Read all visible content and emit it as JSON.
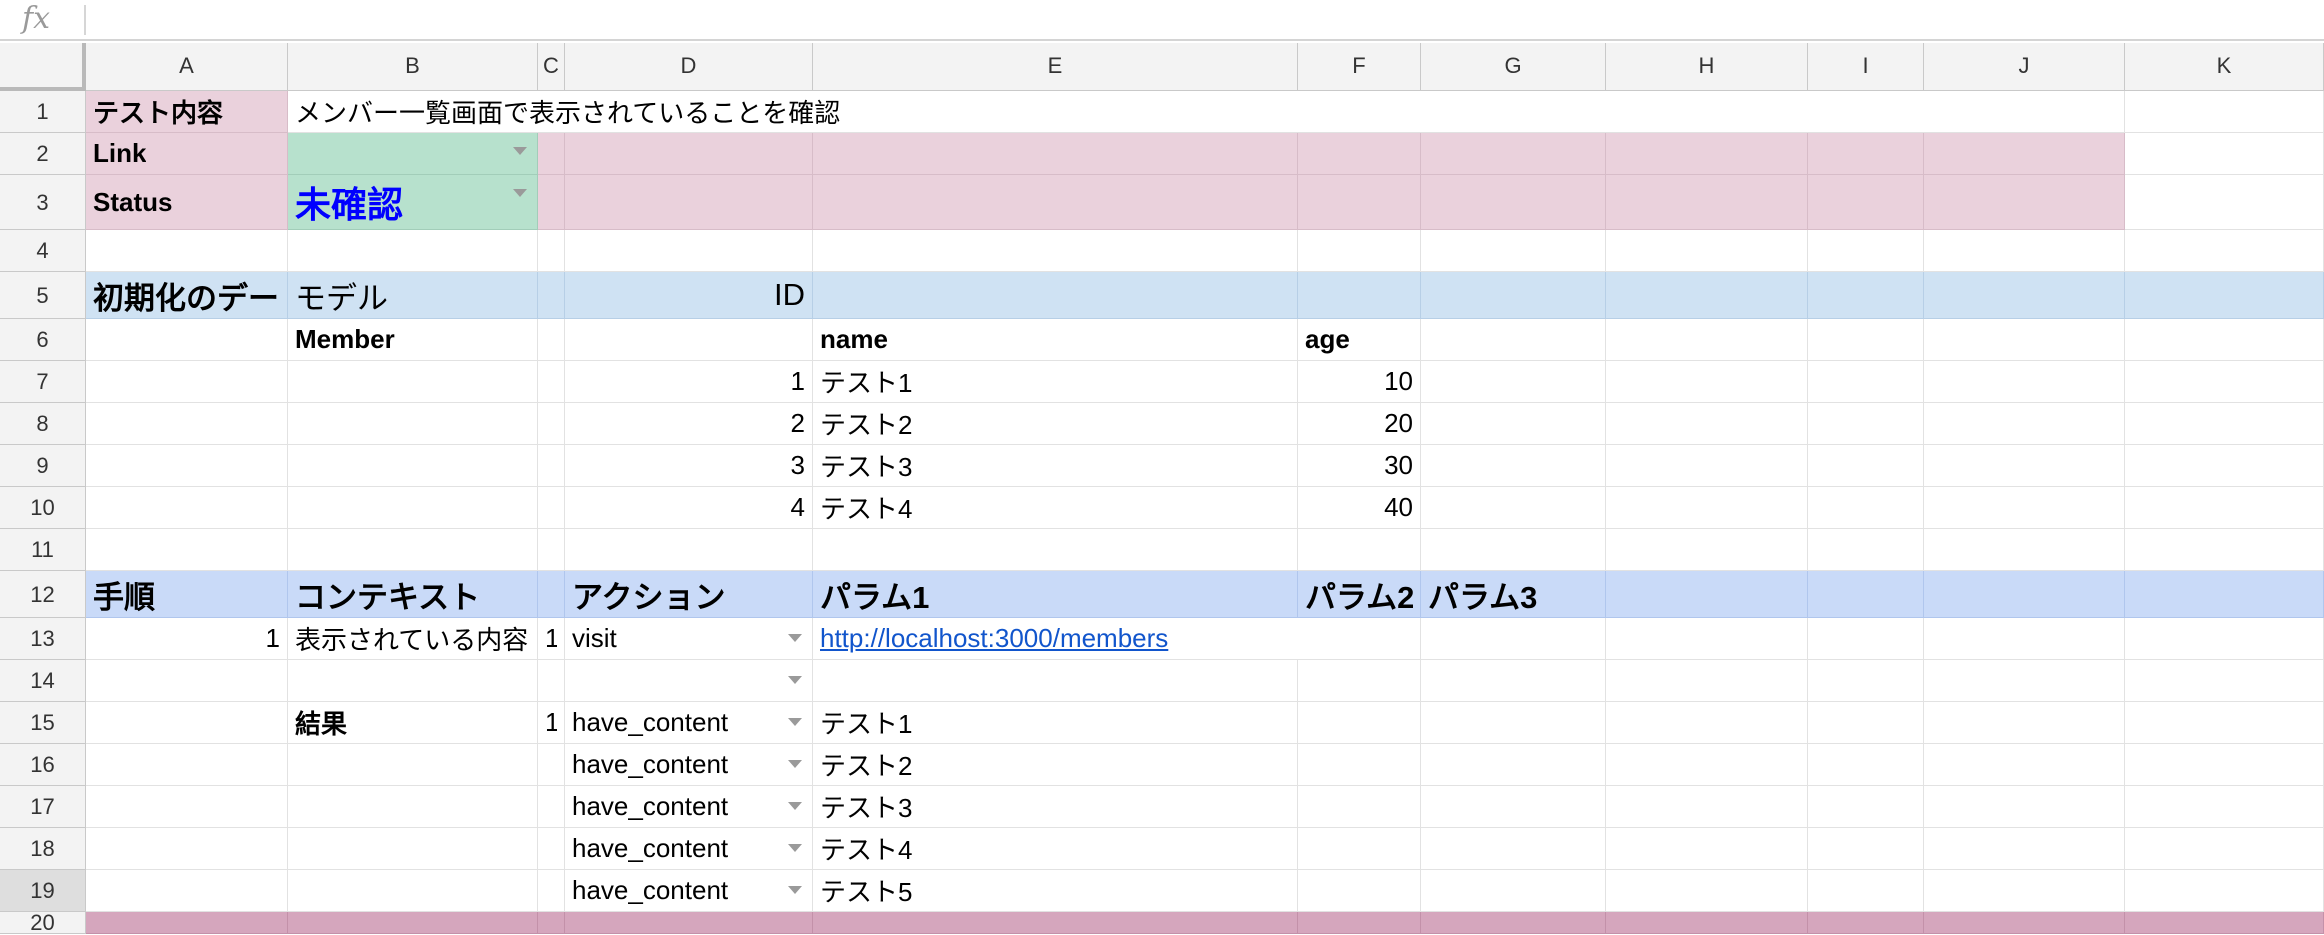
{
  "formula_bar": {
    "icon": "fx",
    "value": ""
  },
  "columns": [
    "A",
    "B",
    "C",
    "D",
    "E",
    "F",
    "G",
    "H",
    "I",
    "J",
    "K"
  ],
  "rows": [
    "1",
    "2",
    "3",
    "4",
    "5",
    "6",
    "7",
    "8",
    "9",
    "10",
    "11",
    "12",
    "13",
    "14",
    "15",
    "16",
    "17",
    "18",
    "19",
    "20"
  ],
  "colors": {
    "pink": "#ead1dc",
    "green": "#b7e1cd",
    "light_blue": "#cfe2f3",
    "blue": "#c9daf8",
    "dark_pink": "#d5a6bd",
    "status_blue": "#0000ff",
    "link": "#1155cc"
  },
  "sheet": {
    "r1": {
      "a": "テスト内容",
      "b": "メンバー一覧画面で表示されていることを確認"
    },
    "r2": {
      "a": "Link"
    },
    "r3": {
      "a": "Status",
      "b": "未確認"
    },
    "r5": {
      "a": "初期化のデータ",
      "b": "モデル",
      "d": "ID"
    },
    "r6": {
      "b": "Member",
      "e": "name",
      "f": "age"
    },
    "r7": {
      "d": "1",
      "e": "テスト1",
      "f": "10"
    },
    "r8": {
      "d": "2",
      "e": "テスト2",
      "f": "20"
    },
    "r9": {
      "d": "3",
      "e": "テスト3",
      "f": "30"
    },
    "r10": {
      "d": "4",
      "e": "テスト4",
      "f": "40"
    },
    "r12": {
      "a": "手順",
      "b": "コンテキスト",
      "d": "アクション",
      "e": "パラム1",
      "f": "パラム2",
      "g": "パラム3"
    },
    "r13": {
      "a": "1",
      "b": "表示されている内容が",
      "c": "1",
      "d": "visit",
      "e": "http://localhost:3000/members"
    },
    "r15": {
      "b": "結果",
      "c": "1",
      "d": "have_content",
      "e": "テスト1"
    },
    "r16": {
      "d": "have_content",
      "e": "テスト2"
    },
    "r17": {
      "d": "have_content",
      "e": "テスト3"
    },
    "r18": {
      "d": "have_content",
      "e": "テスト4"
    },
    "r19": {
      "d": "have_content",
      "e": "テスト5"
    }
  }
}
